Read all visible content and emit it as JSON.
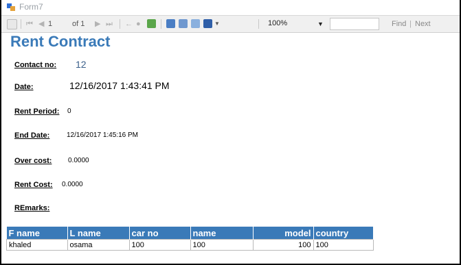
{
  "window": {
    "title": "Form7"
  },
  "toolbar": {
    "first_page": "⏮",
    "prev_page": "◀",
    "current_page": "1",
    "of_pages": "of 1",
    "next_page": "▶",
    "last_page": "⏭",
    "back": "←",
    "stop": "●",
    "refresh": "⟳",
    "zoom": "100%",
    "find": "Find",
    "next": "Next",
    "separator": "|"
  },
  "report": {
    "title": "Rent Contract",
    "fields": [
      {
        "label": "Contact no:",
        "value": "12"
      },
      {
        "label": "Date:",
        "value": "12/16/2017 1:43:41 PM"
      },
      {
        "label": "Rent Period:",
        "value": "0"
      },
      {
        "label": "End Date:",
        "value": "12/16/2017 1:45:16 PM"
      },
      {
        "label": "Over cost:",
        "value": "0.0000"
      },
      {
        "label": "Rent Cost:",
        "value": "0.0000"
      },
      {
        "label": "REmarks:",
        "value": ""
      }
    ]
  },
  "table": {
    "columns": [
      "F name",
      "L name",
      "car no",
      "name",
      "model",
      "country"
    ],
    "rows": [
      [
        "khaled",
        "osama",
        "100",
        "100",
        "100",
        "100"
      ]
    ]
  }
}
